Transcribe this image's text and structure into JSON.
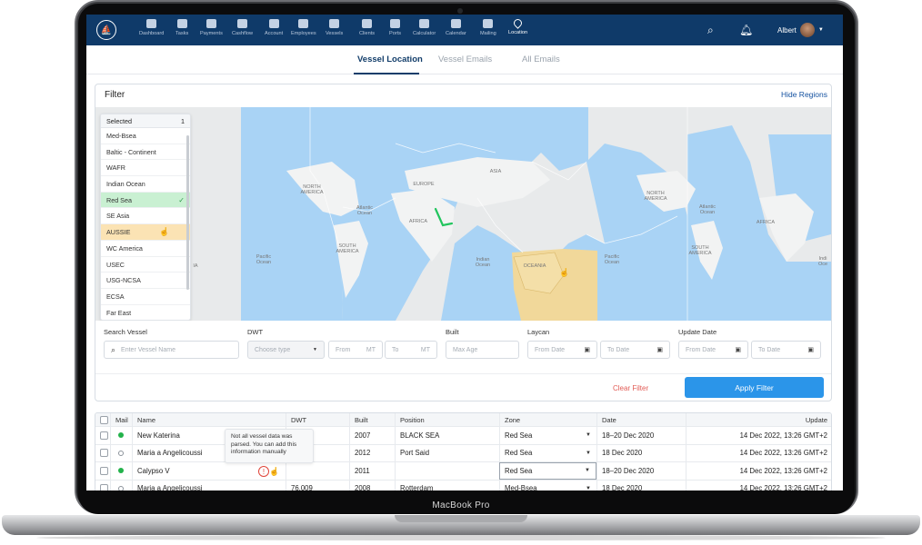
{
  "device": {
    "label": "MacBook Pro"
  },
  "nav": {
    "items": [
      {
        "label": "Dashboard",
        "icon": "dashboard-icon"
      },
      {
        "label": "Tasks",
        "icon": "tasks-icon"
      },
      {
        "label": "Payments",
        "icon": "payments-icon"
      },
      {
        "label": "Cashflow",
        "icon": "cashflow-icon"
      },
      {
        "label": "Account",
        "icon": "account-icon"
      },
      {
        "label": "Employees",
        "icon": "employees-icon"
      },
      {
        "label": "Vessels",
        "icon": "vessels-icon"
      },
      {
        "label": "Clients",
        "icon": "clients-icon"
      },
      {
        "label": "Ports",
        "icon": "ports-icon"
      },
      {
        "label": "Calculator",
        "icon": "calculator-icon"
      },
      {
        "label": "Calendar",
        "icon": "calendar-icon"
      },
      {
        "label": "Mailing",
        "icon": "mailing-icon"
      },
      {
        "label": "Location",
        "icon": "location-icon",
        "active": true
      }
    ],
    "user_name": "Albert"
  },
  "tabs": [
    {
      "label": "Vessel Location",
      "active": true
    },
    {
      "label": "Vessel Emails"
    },
    {
      "label": "All Emails"
    }
  ],
  "filter": {
    "title": "Filter",
    "hide_regions": "Hide Regions",
    "regions_header": "Selected",
    "regions_count": "1",
    "regions": [
      "Med-Bsea",
      "Baltic - Continent",
      "WAFR",
      "Indian Ocean",
      "Red Sea",
      "SE Asia",
      "AUSSIE",
      "WC America",
      "USEC",
      "USG-NCSA",
      "ECSA",
      "Far East"
    ],
    "selected_region": "Red Sea",
    "hovered_region": "AUSSIE",
    "map_labels": {
      "north_america": "NORTH AMERICA",
      "europe": "EUROPE",
      "asia": "ASIA",
      "africa": "AFRICA",
      "south_america": "SOUTH AMERICA",
      "oceania": "OCEANIA",
      "atlantic": "Atlantic Ocean",
      "pacific": "Pacific Ocean",
      "indian": "Indian Ocean",
      "north_america_2": "NORTH AMERICA",
      "atlantic_2": "Atlantic Ocean",
      "africa_2": "AFRICA",
      "south_america_2": "SOUTH AMERICA",
      "pacific_2": "Pacific Ocean",
      "pacific_3": "Pacific Ocean",
      "indian_2": "Indi Oce",
      "edge": "IA"
    },
    "search_vessel": {
      "label": "Search Vessel",
      "placeholder": "Enter Vessel Name"
    },
    "dwt": {
      "label": "DWT",
      "type_placeholder": "Choose type",
      "from": "From",
      "to": "To",
      "unit": "MT"
    },
    "built": {
      "label": "Built",
      "placeholder": "Max Age"
    },
    "laycan": {
      "label": "Laycan",
      "from": "From Date",
      "to": "To Date"
    },
    "update_date": {
      "label": "Update Date",
      "from": "From Date",
      "to": "To Date"
    },
    "clear": "Clear Filter",
    "apply": "Apply Filter"
  },
  "table": {
    "columns": [
      "Mail",
      "Name",
      "DWT",
      "Built",
      "Position",
      "Zone",
      "Date",
      "Update"
    ],
    "rows": [
      {
        "mail": true,
        "name": "New Katerina",
        "dwt": "",
        "built": "2007",
        "position": "BLACK SEA",
        "zone": "Red Sea",
        "date": "18–20 Dec 2020",
        "update": "14 Dec 2022, 13:26 GMT+2"
      },
      {
        "mail": false,
        "name": "Maria a Angelicoussi",
        "dwt": "",
        "built": "2012",
        "position": "Port Said",
        "zone": "Red Sea",
        "date": "18 Dec 2020",
        "update": "14 Dec 2022, 13:26 GMT+2"
      },
      {
        "mail": true,
        "name": "Calypso V",
        "dwt": "",
        "built": "2011",
        "position": "",
        "zone": "Red Sea",
        "date": "18–20 Dec 2020",
        "update": "14 Dec 2022, 13:26 GMT+2"
      },
      {
        "mail": false,
        "name": "Maria a Angelicoussi",
        "dwt": "76,009",
        "built": "2008",
        "position": "Rotterdam",
        "zone": "Med-Bsea",
        "date": "18 Dec 2020",
        "update": "14 Dec 2022, 13:26 GMT+2"
      }
    ],
    "tooltip": "Not all vessel data was parsed. You can add this information manually"
  },
  "colors": {
    "nav": "#0f3a69",
    "region_blue": "#a9d3f5",
    "region_selected": "#f1d89a",
    "apply": "#2b95e9",
    "route": "#22c55e"
  }
}
